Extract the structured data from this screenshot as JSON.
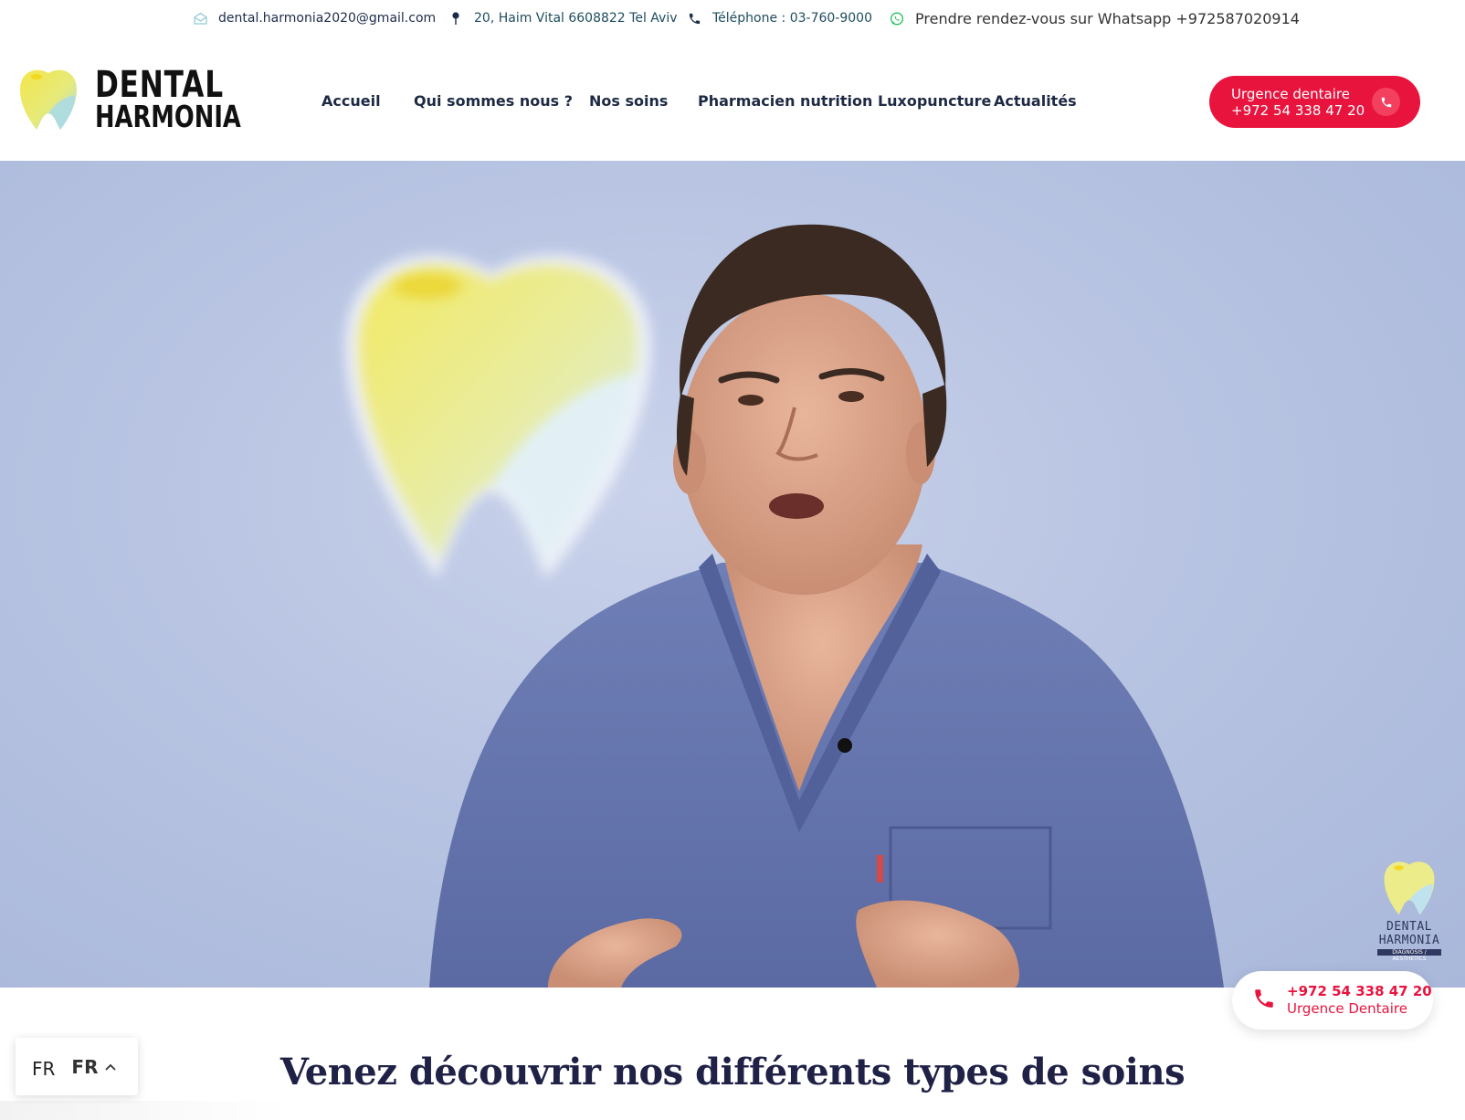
{
  "topbar": {
    "email": "dental.harmonia2020@gmail.com",
    "address": "20, Haim Vital 6608822 Tel Aviv",
    "telephone": "Téléphone : 03-760-9000",
    "whatsapp": "Prendre rendez-vous sur Whatsapp +972587020914"
  },
  "header": {
    "logo_line1": "DENTAL",
    "logo_line2": "HARMONIA",
    "nav": [
      {
        "label": "Accueil"
      },
      {
        "label": "Qui sommes nous ?"
      },
      {
        "label": "Nos soins"
      },
      {
        "label": "Pharmacien nutrition Luxopuncture"
      },
      {
        "label": "Actualités"
      }
    ],
    "urgent_line1": "Urgence dentaire",
    "urgent_line2": "+972 54 338 47 20"
  },
  "hero": {
    "corner_logo_line1": "DENTAL",
    "corner_logo_line2": "HARMONIA",
    "corner_logo_tagline": "DIAGNOSIS / AESTHETICS"
  },
  "call_card": {
    "number": "+972 54 338 47 20",
    "label": "Urgence Dentaire"
  },
  "section": {
    "title": "Venez découvrir nos différents types de soins"
  },
  "language": {
    "flag_alt": "FR",
    "code": "FR"
  },
  "colors": {
    "accent_red": "#e8143e",
    "nav_text": "#1e2a44",
    "title_text": "#1f2146"
  }
}
